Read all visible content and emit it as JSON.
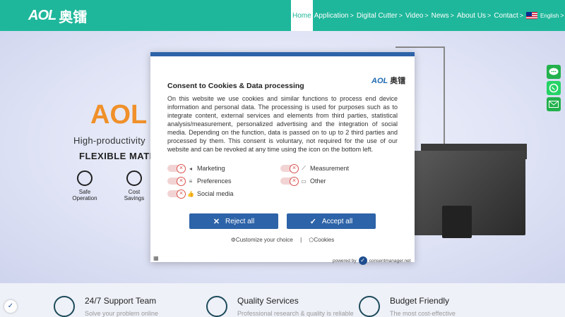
{
  "header": {
    "logo_text": "AOL",
    "logo_cn": "奥镭",
    "nav": [
      {
        "label": "Home",
        "active": true
      },
      {
        "label": "Application",
        "arrow": ">"
      },
      {
        "label": "Digital Cutter",
        "arrow": ">"
      },
      {
        "label": "Video",
        "arrow": ">"
      },
      {
        "label": "News",
        "arrow": ">"
      },
      {
        "label": "About Us",
        "arrow": ">"
      },
      {
        "label": "Contact",
        "arrow": ">"
      }
    ],
    "language": "English",
    "language_arrow": ">",
    "bg_color": "#1fb79b"
  },
  "hero": {
    "brand": "AOL",
    "tagline": "High-productivity",
    "subtitle": "FLEXIBLE MATERI",
    "features": [
      {
        "label": "Safe\nOperation",
        "icon": "target-icon"
      },
      {
        "label": "Cost\nSavings",
        "icon": "dollar-clock-icon"
      }
    ]
  },
  "side_buttons": [
    {
      "icon": "chat-icon",
      "color": "#22b14c"
    },
    {
      "icon": "whatsapp-icon",
      "color": "#25d366"
    },
    {
      "icon": "email-icon",
      "color": "#22b14c"
    }
  ],
  "consent": {
    "title": "Consent to Cookies & Data processing",
    "logo_text": "AOL",
    "logo_cn": "奥镭",
    "body": "On this website we use cookies and similar functions to process end device information and personal data. The processing is used for purposes such as to integrate content, external services and elements from third parties, statistical analysis/measurement, personalized advertising and the integration of social media. Depending on the function, data is passed on to up to 2 third parties and processed by them. This consent is voluntary, not required for the use of our website and can be revoked at any time using the icon on the bottom left.",
    "categories": [
      {
        "label": "Marketing",
        "icon": "megaphone-icon"
      },
      {
        "label": "Measurement",
        "icon": "chart-icon"
      },
      {
        "label": "Preferences",
        "icon": "sliders-icon"
      },
      {
        "label": "Other",
        "icon": "chat-bubbles-icon"
      },
      {
        "label": "Social media",
        "icon": "thumbs-up-icon"
      }
    ],
    "reject_label": "Reject all",
    "accept_label": "Accept all",
    "customize_label": "Customize your choice",
    "separator": "|",
    "cookies_label": "Cookies",
    "powered_by": "powered by",
    "provider": "consentmanager.net",
    "accent_color": "#2d63a8"
  },
  "bottom_features": [
    {
      "title": "24/7 Support Team",
      "subtitle": "Solve your problem online",
      "icon": "chat-support-icon"
    },
    {
      "title": "Quality Services",
      "subtitle": "Professional research & quality is reliable",
      "icon": "thumbs-up-icon"
    },
    {
      "title": "Budget Friendly",
      "subtitle": "The most cost-effective",
      "icon": "money-hand-icon"
    }
  ]
}
